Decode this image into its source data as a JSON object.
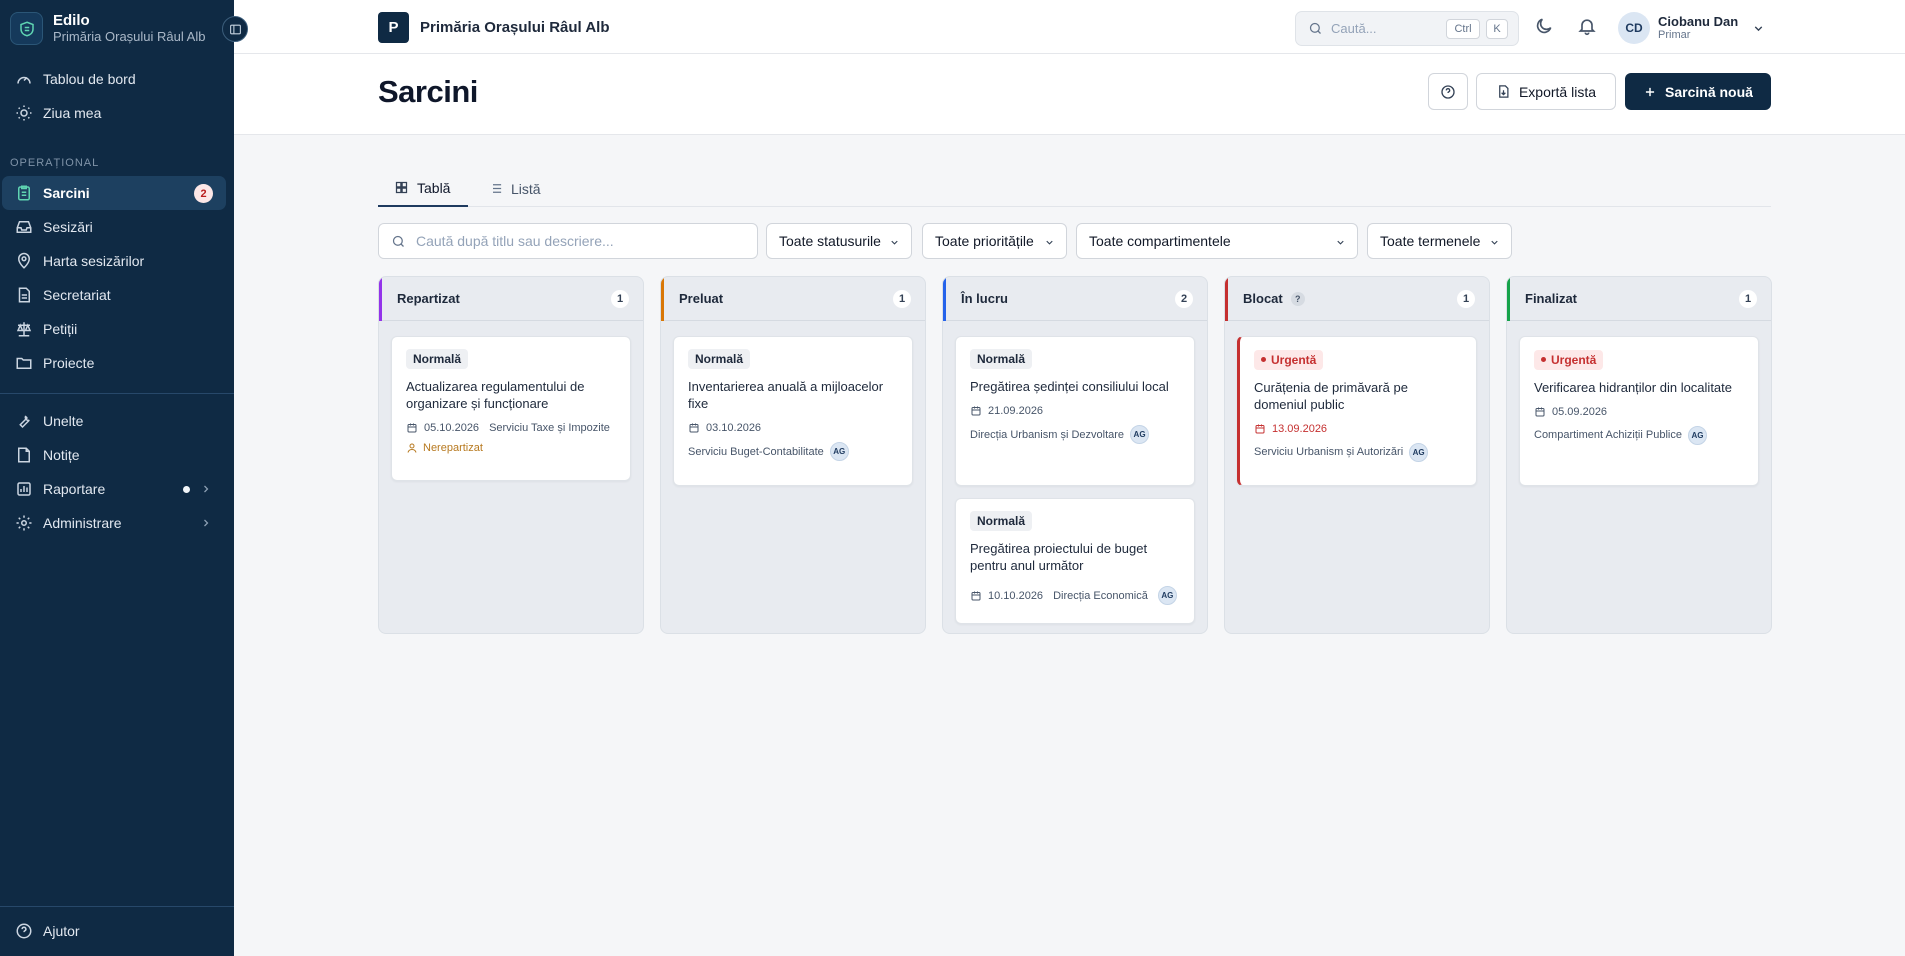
{
  "app": {
    "name": "Edilo",
    "org": "Primăria Orașului Râul Alb"
  },
  "sidebar": {
    "top_items": [
      {
        "label": "Tablou de bord",
        "icon": "gauge-icon"
      },
      {
        "label": "Ziua mea",
        "icon": "sun-icon"
      }
    ],
    "section_label": "OPERAȚIONAL",
    "ops_items": [
      {
        "label": "Sarcini",
        "icon": "clipboard-icon",
        "badge": "2",
        "active": true
      },
      {
        "label": "Sesizări",
        "icon": "inbox-icon"
      },
      {
        "label": "Harta sesizărilor",
        "icon": "map-pin-icon"
      },
      {
        "label": "Secretariat",
        "icon": "document-icon"
      },
      {
        "label": "Petiții",
        "icon": "scale-icon"
      },
      {
        "label": "Proiecte",
        "icon": "folder-icon"
      }
    ],
    "tool_items": [
      {
        "label": "Unelte",
        "icon": "wrench-icon"
      },
      {
        "label": "Notițe",
        "icon": "note-icon"
      },
      {
        "label": "Raportare",
        "icon": "report-icon"
      },
      {
        "label": "Administrare",
        "icon": "gear-icon"
      }
    ],
    "help_label": "Ajutor"
  },
  "header": {
    "org_initial": "P",
    "org_name": "Primăria Orașului Râul Alb",
    "search_placeholder": "Caută...",
    "kbd_ctrl": "Ctrl",
    "kbd_k": "K",
    "user": {
      "initials": "CD",
      "name": "Ciobanu Dan",
      "role": "Primar"
    }
  },
  "page": {
    "title": "Sarcini",
    "export_label": "Exportă lista",
    "new_label": "Sarcină nouă"
  },
  "tabs": [
    {
      "label": "Tablă"
    },
    {
      "label": "Listă"
    }
  ],
  "filters": {
    "search_placeholder": "Caută după titlu sau descriere...",
    "status": "Toate statusurile",
    "priority": "Toate prioritățile",
    "department": "Toate compartimentele",
    "deadline": "Toate termenele"
  },
  "colors": {
    "accent": "#0f2a44",
    "urgent": "#c53030"
  },
  "board": [
    {
      "name": "Repartizat",
      "count": "1",
      "color": "#9333ea",
      "cards": [
        {
          "priority": "Normală",
          "urgent": false,
          "title": "Actualizarea regulamentului de organizare și funcționare",
          "date": "05.10.2026",
          "dept": "Serviciu Taxe și Impozite",
          "assignee": "",
          "unassigned": "Nerepartizat"
        }
      ]
    },
    {
      "name": "Preluat",
      "count": "1",
      "color": "#d97706",
      "cards": [
        {
          "priority": "Normală",
          "urgent": false,
          "title": "Inventarierea anuală a mijloacelor fixe",
          "date": "03.10.2026",
          "dept": "Serviciu Buget-Contabilitate",
          "assignee": "AG"
        }
      ]
    },
    {
      "name": "În lucru",
      "count": "2",
      "color": "#2563eb",
      "cards": [
        {
          "priority": "Normală",
          "urgent": false,
          "title": "Pregătirea ședinței consiliului local",
          "date": "21.09.2026",
          "dept": "Direcția Urbanism și Dezvoltare",
          "assignee": "AG"
        },
        {
          "priority": "Normală",
          "urgent": false,
          "title": "Pregătirea proiectului de buget pentru anul următor",
          "date": "10.10.2026",
          "dept": "Direcția Economică",
          "assignee": "AG"
        }
      ]
    },
    {
      "name": "Blocat",
      "count": "1",
      "color": "#c53030",
      "help": "?",
      "cards": [
        {
          "priority": "Urgentă",
          "urgent": true,
          "title": "Curățenia de primăvară pe domeniul public",
          "date": "13.09.2026",
          "dept": "Serviciu Urbanism și Autorizări",
          "assignee": "AG",
          "overdue": true
        }
      ]
    },
    {
      "name": "Finalizat",
      "count": "1",
      "color": "#16a34a",
      "cards": [
        {
          "priority": "Urgentă",
          "urgent": true,
          "title": "Verificarea hidranților din localitate",
          "date": "05.09.2026",
          "dept": "Compartiment Achiziții Publice",
          "assignee": "AG"
        }
      ]
    }
  ]
}
